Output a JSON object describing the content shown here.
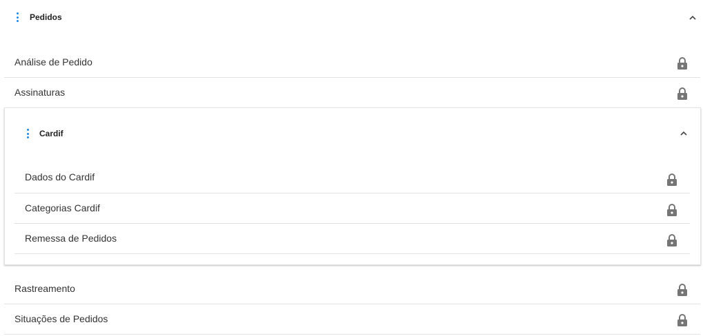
{
  "pedidos": {
    "title": "Pedidos",
    "expand_icon": "chevron-up-icon",
    "menu_icon": "vertical-dots-icon",
    "items": [
      {
        "label": "Análise de Pedido",
        "icon": "lock-icon"
      },
      {
        "label": "Assinaturas",
        "icon": "lock-icon"
      }
    ]
  },
  "cardif": {
    "title": "Cardif",
    "expand_icon": "chevron-up-icon",
    "menu_icon": "vertical-dots-icon",
    "items": [
      {
        "label": "Dados do Cardif",
        "icon": "lock-icon"
      },
      {
        "label": "Categorias Cardif",
        "icon": "lock-icon"
      },
      {
        "label": "Remessa de Pedidos",
        "icon": "lock-icon"
      }
    ]
  },
  "after_items": [
    {
      "label": "Rastreamento",
      "icon": "lock-icon"
    },
    {
      "label": "Situações de Pedidos",
      "icon": "lock-icon"
    }
  ],
  "colors": {
    "accent": "#1e88e5",
    "lock": "#757575",
    "divider": "#e2e2e2",
    "text": "#333333"
  }
}
